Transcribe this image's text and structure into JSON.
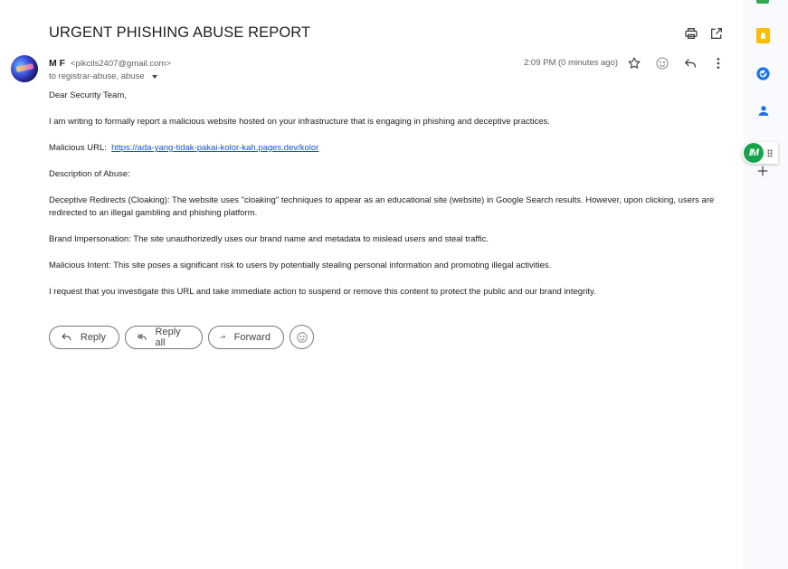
{
  "email": {
    "subject": "URGENT PHISHING ABUSE REPORT",
    "sender_name": "M F",
    "sender_email": "<pikcils2407@gmail.com>",
    "recipients": "to registrar-abuse, abuse",
    "time": "2:09 PM (0 minutes ago)",
    "body": {
      "greeting": "Dear Security Team,",
      "intro": "I am writing to formally report a malicious website hosted on your infrastructure that is engaging in phishing and deceptive practices.",
      "url_label": "Malicious URL:",
      "url": "https://ada-yang-tidak-pakai-kolor-kah.pages.dev/kolor",
      "description_heading": "Description of Abuse:",
      "cloaking": "Deceptive Redirects (Cloaking): The website uses \"cloaking\" techniques to appear as an educational site (website) in Google Search results. However, upon clicking, users are redirected to an illegal gambling and phishing platform.",
      "impersonation": "Brand Impersonation: The site unauthorizedly uses our brand name and metadata to mislead users and steal traffic.",
      "intent": "Malicious Intent: This site poses a significant risk to users by potentially stealing personal information and promoting illegal activities.",
      "request": "I request that you investigate this URL and take immediate action to suspend or remove this content to protect the public and our brand integrity."
    }
  },
  "actions": {
    "reply": "Reply",
    "reply_all": "Reply all",
    "forward": "Forward"
  },
  "side_rail": {
    "addon_logo_text": "IM",
    "icons": [
      "sheets-icon",
      "keep-icon",
      "tasks-icon",
      "contacts-icon",
      "addon-icon",
      "add-icon"
    ]
  },
  "colors": {
    "link": "#1155cc",
    "keep": "#fbbc04",
    "tasks": "#1a73e8",
    "contacts": "#1a73e8",
    "addon": "#16a34a"
  }
}
